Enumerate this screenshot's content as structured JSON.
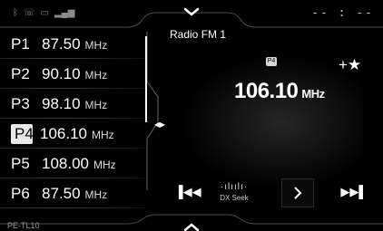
{
  "station": {
    "name": "Radio FM 1",
    "frequency": "106.10",
    "unit": "MHz",
    "preset_badge": "P4"
  },
  "clock": "-- : --",
  "presets": [
    {
      "num": "P1",
      "freq": "87.50",
      "unit": "MHz"
    },
    {
      "num": "P2",
      "freq": "90.10",
      "unit": "MHz"
    },
    {
      "num": "P3",
      "freq": "98.10",
      "unit": "MHz"
    },
    {
      "num": "P4",
      "freq": "106.10",
      "unit": "MHz",
      "active": true
    },
    {
      "num": "P5",
      "freq": "108.00",
      "unit": "MHz"
    },
    {
      "num": "P6",
      "freq": "87.50",
      "unit": "MHz"
    }
  ],
  "controls": {
    "dx_seek_label": "DX Seek"
  },
  "footer_label": "PE-TL10",
  "icons": {
    "favorite": "add-favorite-icon",
    "prev": "seek-back-icon",
    "next": "next-page-icon",
    "skip": "seek-forward-icon"
  },
  "colors": {
    "background": "#000000",
    "text": "#ffffff",
    "active_badge": "#e8e8e8"
  }
}
